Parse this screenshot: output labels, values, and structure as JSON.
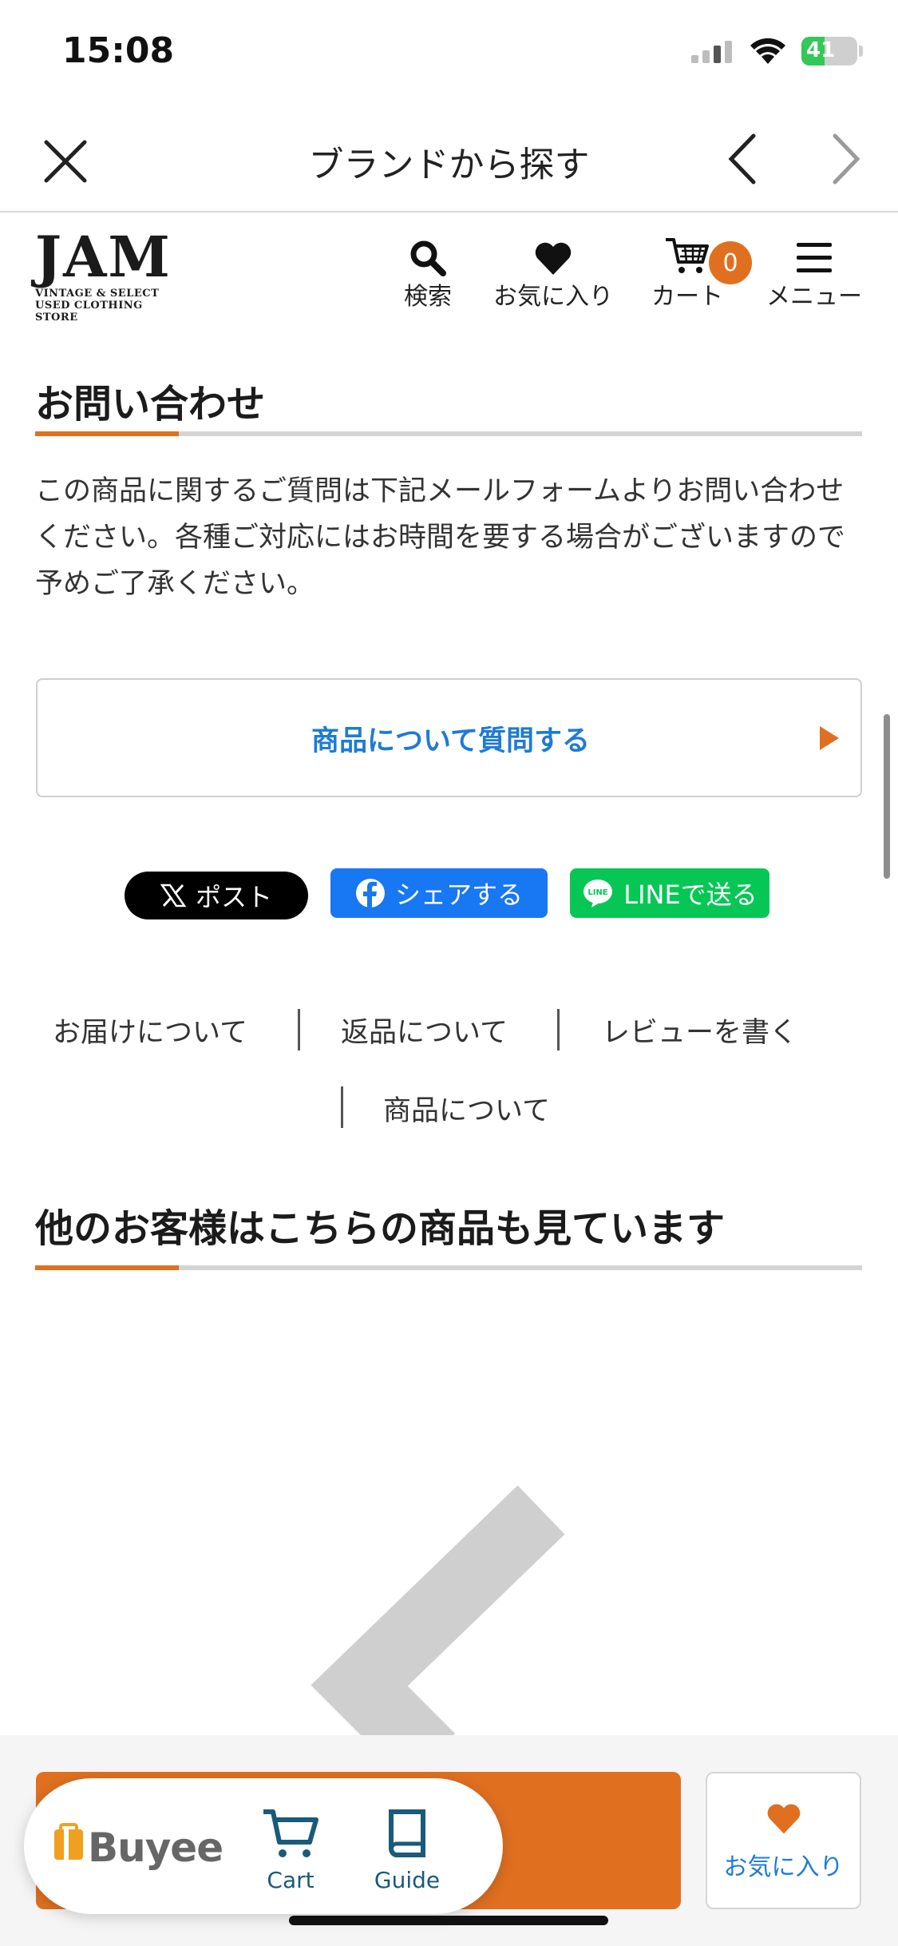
{
  "status": {
    "time": "15:08",
    "battery": "41"
  },
  "nav": {
    "title": "ブランドから探す"
  },
  "header": {
    "logo_main": "JAM",
    "logo_sub_1": "VINTAGE & SELECT",
    "logo_sub_2": "USED CLOTHING STORE",
    "search_label": "検索",
    "favorites_label": "お気に入り",
    "cart_label": "カート",
    "cart_count": "0",
    "menu_label": "メニュー"
  },
  "inquiry": {
    "heading": "お問い合わせ",
    "text": "この商品に関するご質問は下記メールフォームよりお問い合わせください。各種ご対応にはお時間を要する場合がございますので予めご了承ください。",
    "button_label": "商品について質問する"
  },
  "share": {
    "x_label": "ポスト",
    "facebook_label": "シェアする",
    "line_label": "LINEで送る",
    "line_badge": "LINE"
  },
  "info_links": [
    "お届けについて",
    "返品について",
    "レビューを書く",
    "商品について"
  ],
  "recommend": {
    "heading": "他のお客様はこちらの商品も見ています"
  },
  "bottom": {
    "favorite_label": "お気に入り"
  },
  "buyee": {
    "logo": "Buyee",
    "cart_label": "Cart",
    "guide_label": "Guide"
  },
  "colors": {
    "accent": "#e07020",
    "link": "#1e7bd4",
    "facebook": "#1877f2",
    "line": "#06c755"
  }
}
